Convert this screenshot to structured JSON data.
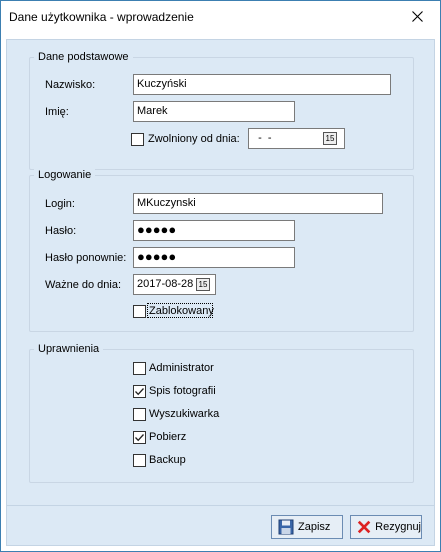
{
  "window": {
    "title": "Dane użytkownika - wprowadzenie"
  },
  "basic": {
    "title": "Dane podstawowe",
    "surname_label": "Nazwisko:",
    "surname_value": "Kuczyński",
    "name_label": "Imię:",
    "name_value": "Marek",
    "fired_label": "Zwolniony od dnia:",
    "fired_checked": false,
    "fired_date": "  -  -"
  },
  "login": {
    "title": "Logowanie",
    "login_label": "Login:",
    "login_value": "MKuczynski",
    "password_label": "Hasło:",
    "password_value": "●●●●●",
    "password2_label": "Hasło ponownie:",
    "password2_value": "●●●●●",
    "valid_label": "Ważne do dnia:",
    "valid_value": "2017-08-28",
    "blocked_label": "Zablokowany",
    "blocked_checked": false
  },
  "permissions": {
    "title": "Uprawnienia",
    "items": [
      {
        "label": "Administrator",
        "checked": false
      },
      {
        "label": "Spis fotografii",
        "checked": true
      },
      {
        "label": "Wyszukiwarka",
        "checked": false
      },
      {
        "label": "Pobierz",
        "checked": true
      },
      {
        "label": "Backup",
        "checked": false
      }
    ]
  },
  "buttons": {
    "save_label": "Zapisz",
    "cancel_label": "Rezygnuj"
  },
  "icons": {
    "calendar": "calendar-icon",
    "save": "floppy-icon",
    "cancel": "cross-icon",
    "close": "close-icon"
  },
  "calendar_glyph": "15"
}
